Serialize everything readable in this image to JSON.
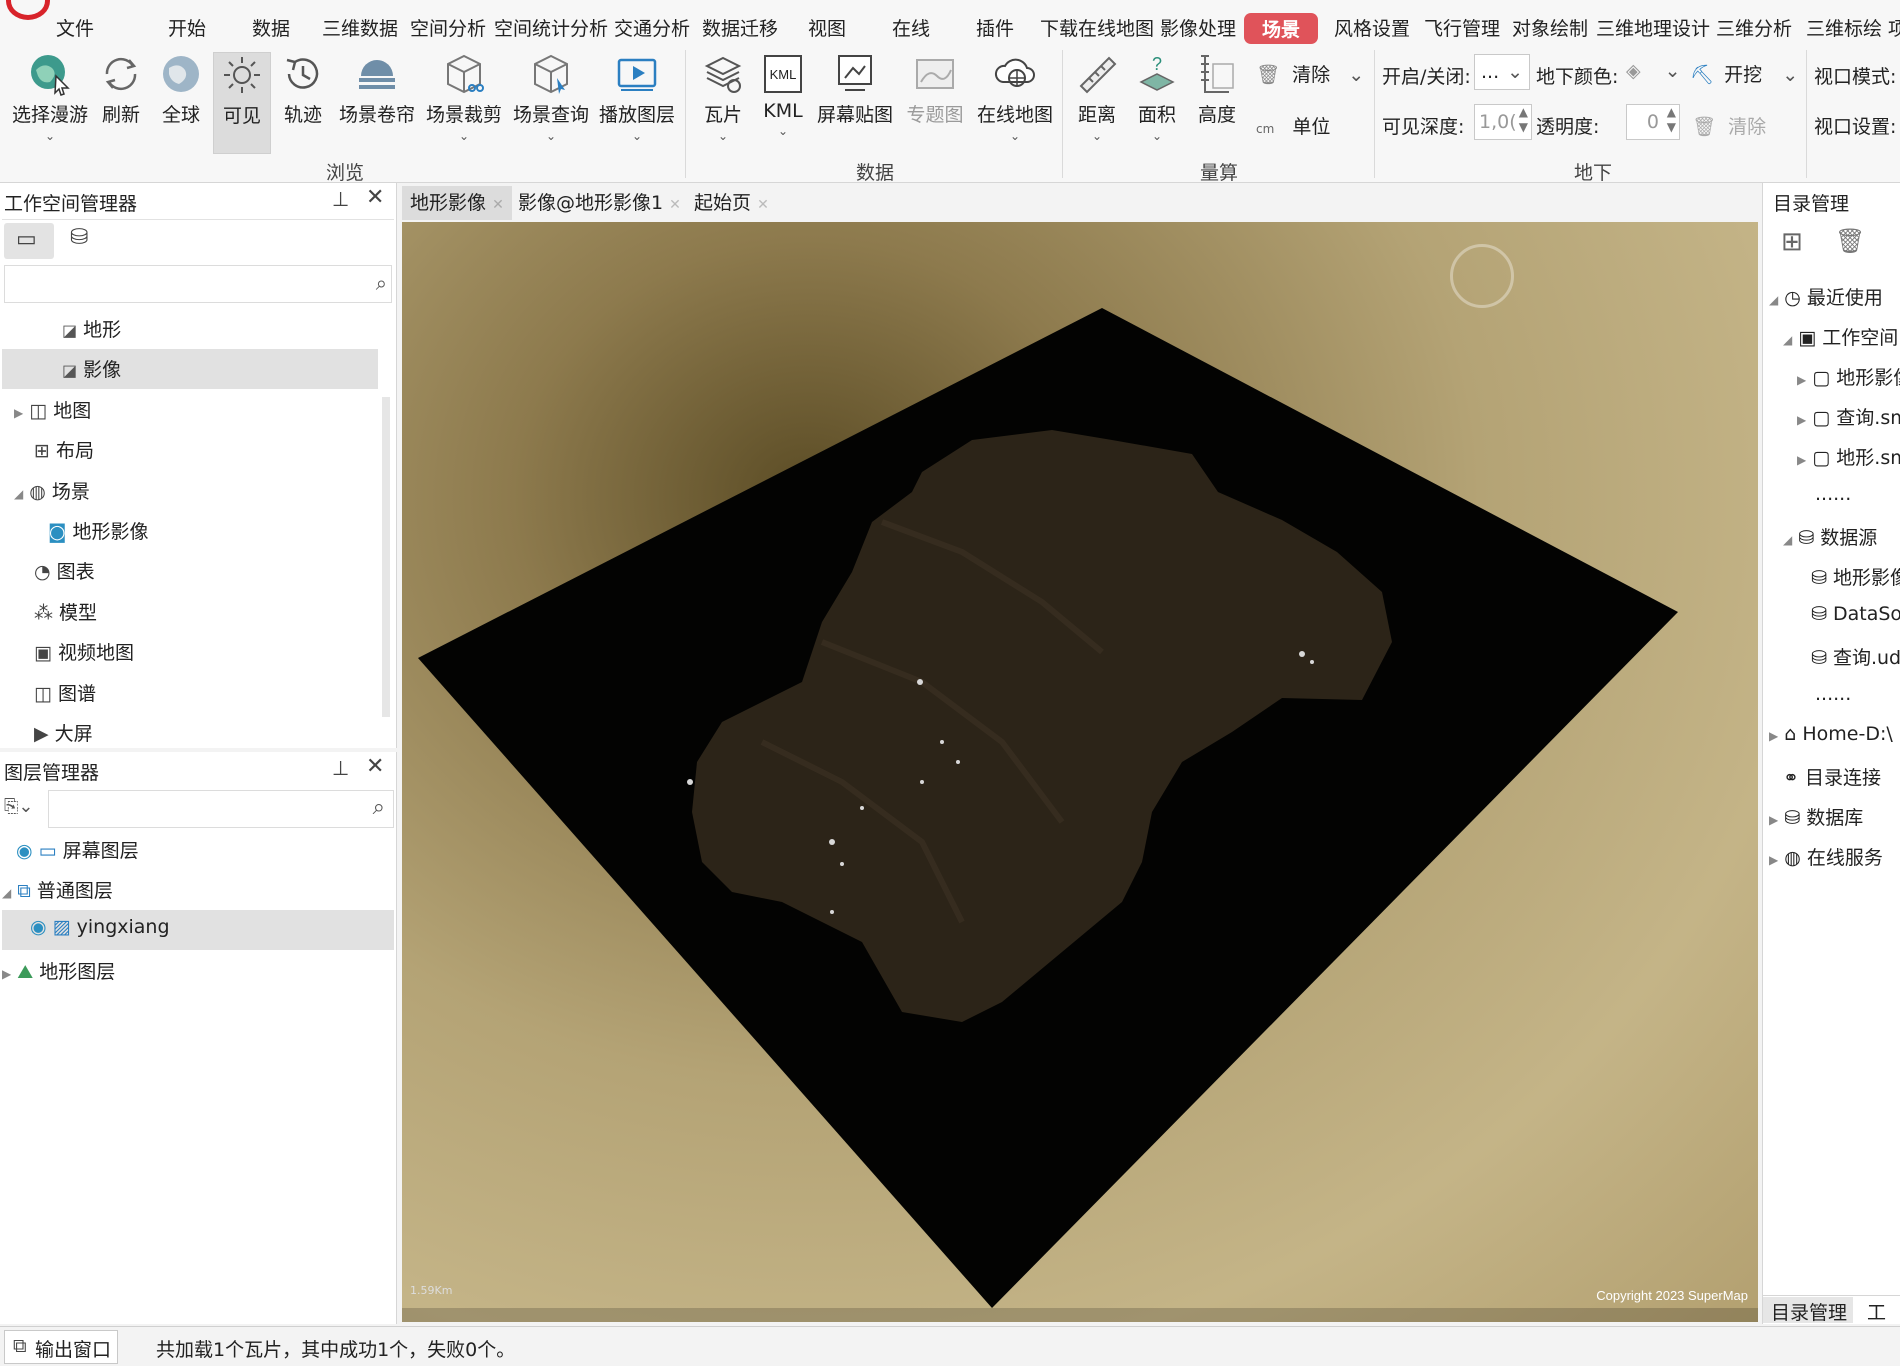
{
  "menubar": {
    "items": [
      "文件",
      "开始",
      "数据",
      "三维数据",
      "空间分析",
      "空间统计分析",
      "交通分析",
      "数据迁移",
      "视图",
      "在线",
      "插件",
      "下载在线地图",
      "影像处理",
      "场景",
      "风格设置",
      "飞行管理",
      "对象绘制",
      "三维地理设计",
      "三维分析",
      "三维标绘",
      "项"
    ],
    "active": "场景",
    "accent_color": "#e0535a"
  },
  "ribbon": {
    "browse_buttons": [
      "选择漫游",
      "刷新",
      "全球",
      "可见",
      "轨迹",
      "场景卷帘",
      "场景裁剪",
      "场景查询",
      "播放图层"
    ],
    "data_buttons": [
      "瓦片",
      "KML",
      "屏幕贴图",
      "专题图",
      "在线地图"
    ],
    "measure_buttons": [
      "距离",
      "面积",
      "高度"
    ],
    "clear_label": "清除",
    "unit_label": "单位",
    "underground": {
      "toggle_label": "开启/关闭:",
      "toggle_value": "...",
      "color_label": "地下颜色:",
      "excavate_label": "开挖",
      "depth_label": "可见深度:",
      "depth_value": "1,0(",
      "transparency_label": "透明度:",
      "transparency_value": "0",
      "clear_label": "清除"
    },
    "viewport_mode_label": "视口模式:",
    "viewport_setting_label": "视口设置:",
    "groups": {
      "browse": "浏览",
      "data": "数据",
      "measure": "量算",
      "underground": "地下"
    }
  },
  "workspace_panel": {
    "title": "工作空间管理器",
    "search_placeholder": "",
    "items": [
      "地形",
      "影像",
      "地图",
      "布局",
      "场景",
      "地形影像",
      "图表",
      "模型",
      "视频地图",
      "图谱",
      "大屏"
    ],
    "selected": "影像"
  },
  "layer_panel": {
    "title": "图层管理器",
    "items": [
      "屏幕图层",
      "普通图层",
      "yingxiang",
      "地形图层"
    ],
    "selected": "yingxiang"
  },
  "tabs": [
    "地形影像",
    "影像@地形影像1",
    "起始页"
  ],
  "map": {
    "copyright": "Copyright 2023 SuperMap",
    "scale_text": "1.59Km"
  },
  "catalog_panel": {
    "title": "目录管理",
    "items": [
      "最近使用",
      "工作空间",
      "地形影像",
      "查询.sm",
      "地形.sm",
      "......",
      "数据源",
      "地形影像",
      "DataSo",
      "查询.ud",
      "......",
      "Home-D:\\",
      "目录连接",
      "数据库",
      "在线服务"
    ],
    "bottom_tabs": [
      "目录管理",
      "工具"
    ]
  },
  "status": {
    "output_window_label": "输出窗口",
    "message": "共加载1个瓦片，其中成功1个，失败0个。"
  }
}
